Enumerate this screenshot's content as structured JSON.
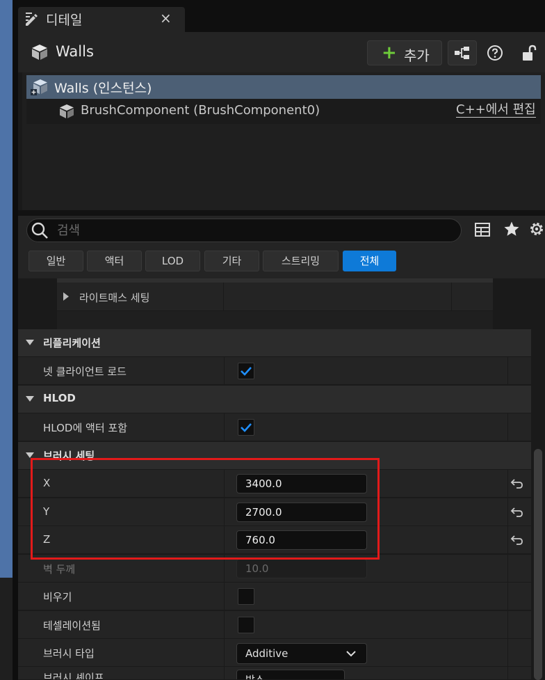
{
  "tab": {
    "title": "디테일",
    "close": "×"
  },
  "header": {
    "actor_name": "Walls",
    "add_label": "추가",
    "add_plus": "+"
  },
  "tree": {
    "root_label": "Walls (인스턴스)",
    "child_label": "BrushComponent (BrushComponent0)",
    "child_action": "C++에서 편집"
  },
  "search": {
    "placeholder": "검색",
    "value": ""
  },
  "filter_tabs": [
    "일반",
    "액터",
    "LOD",
    "기타",
    "스트리밍",
    "전체"
  ],
  "filter_active": "전체",
  "properties": {
    "lightmass_label": "라이트매스 세팅",
    "replication": {
      "category": "리플리케이션",
      "net_load_label": "넷 클라이언트 로드",
      "net_load_checked": true
    },
    "hlod": {
      "category": "HLOD",
      "include_label": "HLOD에 액터 포함",
      "include_checked": true
    },
    "brush": {
      "category": "브러시 세팅",
      "x_label": "X",
      "x_value": "3400.0",
      "y_label": "Y",
      "y_value": "2700.0",
      "z_label": "Z",
      "z_value": "760.0",
      "wall_label": "벽 두께",
      "wall_value": "10.0",
      "hollow_label": "비우기",
      "hollow_checked": false,
      "tess_label": "테셀레이션됨",
      "tess_checked": false,
      "type_label": "브러시 타입",
      "type_value": "Additive",
      "shape_label": "브러시 셰이프",
      "shape_value": "박스"
    }
  },
  "colors": {
    "accent": "#0e7ad8",
    "highlight": "#e21a1a",
    "add_plus": "#6ecb3a",
    "selection": "#4c5f75"
  },
  "icons": [
    "details-icon",
    "close-icon",
    "actor-cube-icon",
    "plus-icon",
    "blueprint-icon",
    "help-icon",
    "lock-icon",
    "search-icon",
    "table-icon",
    "star-icon",
    "gear-icon",
    "expand-arrow-icon",
    "collapse-arrow-icon",
    "checkbox-check-icon",
    "reset-arrow-icon",
    "chevron-down-icon"
  ]
}
